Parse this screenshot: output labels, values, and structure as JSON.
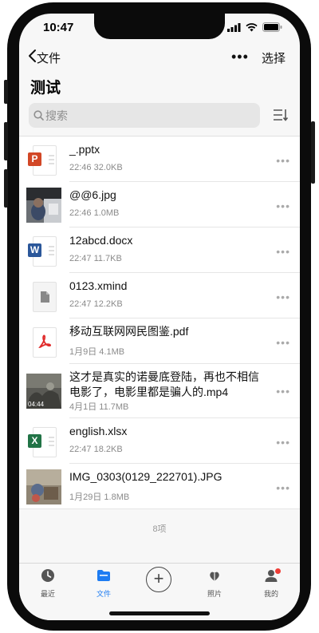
{
  "status": {
    "time": "10:47"
  },
  "nav": {
    "back_label": "文件",
    "select_label": "选择",
    "more_label": "•••"
  },
  "page": {
    "title": "测试"
  },
  "search": {
    "placeholder": "搜索"
  },
  "files": [
    {
      "name": "_.pptx",
      "meta": "22:46 32.0KB",
      "thumb": "ppt-icon"
    },
    {
      "name": "@@6.jpg",
      "meta": "22:46 1.0MB",
      "thumb": "photo-thumbnail"
    },
    {
      "name": "12abcd.docx",
      "meta": "22:47 11.7KB",
      "thumb": "word-icon"
    },
    {
      "name": "0123.xmind",
      "meta": "22:47 12.2KB",
      "thumb": "generic-file-icon"
    },
    {
      "name": "移动互联网网民图鉴.pdf",
      "meta": "1月9日 4.1MB",
      "thumb": "pdf-icon"
    },
    {
      "name": "这才是真实的诺曼底登陆，再也不相信电影了，电影里都是骗人的.mp4",
      "meta": "4月1日 11.7MB",
      "thumb": "video-thumbnail",
      "duration": "04:44"
    },
    {
      "name": "english.xlsx",
      "meta": "22:47 18.2KB",
      "thumb": "excel-icon"
    },
    {
      "name": "IMG_0303(0129_222701).JPG",
      "meta": "1月29日 1.8MB",
      "thumb": "photo-thumbnail"
    }
  ],
  "summary": {
    "count": "8项"
  },
  "tabs": [
    {
      "label": "最近",
      "icon": "clock-icon"
    },
    {
      "label": "文件",
      "icon": "folder-icon",
      "active": true
    },
    {
      "label": "",
      "icon": "plus-icon"
    },
    {
      "label": "照片",
      "icon": "photos-icon"
    },
    {
      "label": "我的",
      "icon": "person-icon"
    }
  ],
  "colors": {
    "accent": "#1e7cf2",
    "ppt": "#d24726",
    "word": "#2b579a",
    "excel": "#217346",
    "pdf": "#e02b2b",
    "notification": "#ef3d36"
  }
}
